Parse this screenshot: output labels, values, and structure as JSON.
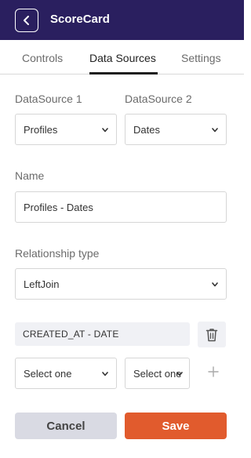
{
  "header": {
    "title": "ScoreCard",
    "back_icon": "chevron-left-icon",
    "bg_color": "#2a1f5f"
  },
  "tabs": [
    {
      "label": "Controls",
      "active": false
    },
    {
      "label": "Data Sources",
      "active": true
    },
    {
      "label": "Settings",
      "active": false
    }
  ],
  "form": {
    "datasource1": {
      "label": "DataSource 1",
      "value": "Profiles"
    },
    "datasource2": {
      "label": "DataSource 2",
      "value": "Dates"
    },
    "name": {
      "label": "Name",
      "value": "Profiles - Dates"
    },
    "relationship_type": {
      "label": "Relationship type",
      "value": "LeftJoin"
    },
    "relationships": [
      {
        "text": "CREATED_AT - DATE"
      }
    ],
    "new_relationship": {
      "left_placeholder": "Select one",
      "right_placeholder": "Select one"
    }
  },
  "icons": {
    "delete": "trash-icon",
    "add": "plus-icon",
    "dropdown": "chevron-down-icon"
  },
  "actions": {
    "cancel_label": "Cancel",
    "save_label": "Save",
    "save_color": "#e15b2d"
  }
}
